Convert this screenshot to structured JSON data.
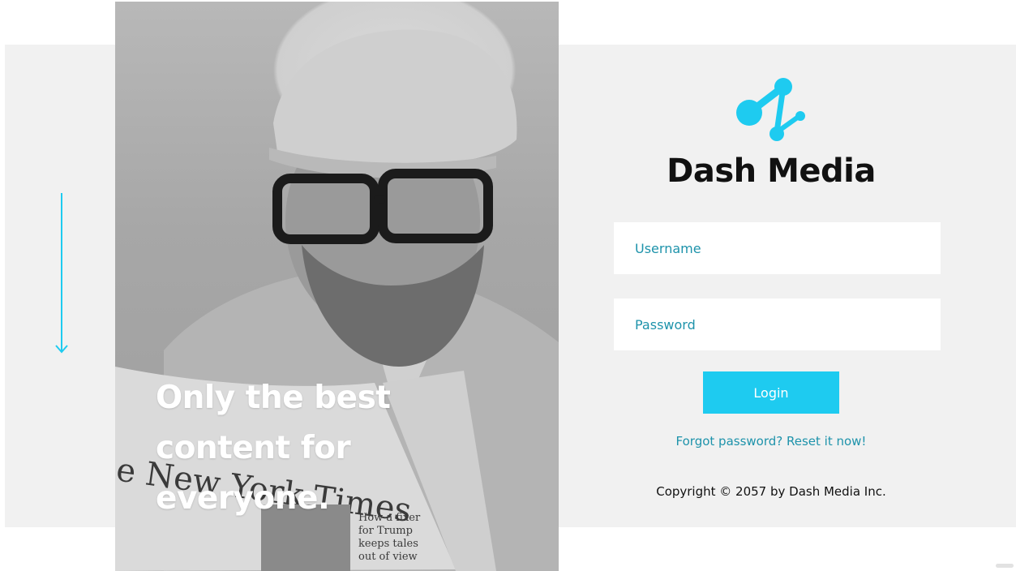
{
  "hero": {
    "tagline_lines": [
      "Only the best",
      "content for",
      "everyone."
    ]
  },
  "brand": {
    "name": "Dash Media",
    "logo_icon": "molecule-logo-icon",
    "accent_color": "#1ecbf0",
    "link_color": "#1e93ab"
  },
  "login_form": {
    "username_placeholder": "Username",
    "password_placeholder": "Password",
    "login_label": "Login",
    "forgot_link": "Forgot password? Reset it now!"
  },
  "footer": {
    "copyright": "Copyright © 2057 by Dash Media Inc."
  },
  "decor": {
    "scroll_icon": "arrow-down-icon"
  }
}
